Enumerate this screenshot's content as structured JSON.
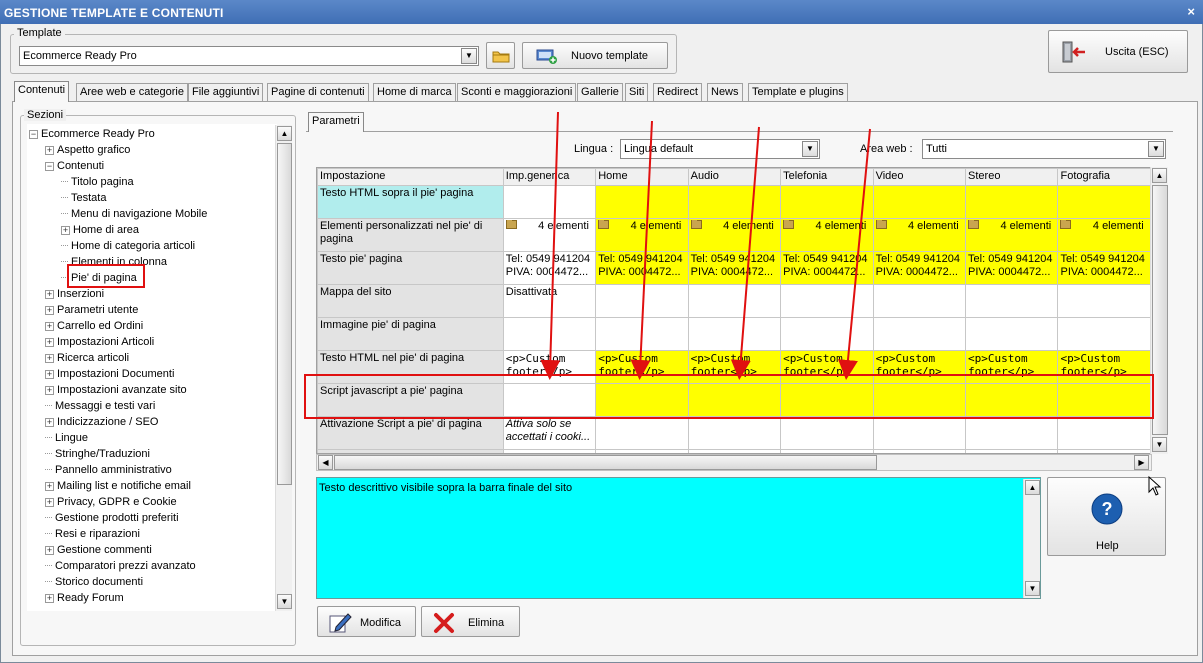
{
  "window": {
    "title": "GESTIONE TEMPLATE E CONTENUTI",
    "close_glyph": "×"
  },
  "template_group": {
    "label": "Template",
    "selected": "Ecommerce Ready Pro",
    "new_button": "Nuovo template"
  },
  "exit_button": "Uscita (ESC)",
  "tabs": [
    {
      "label": "Contenuti"
    },
    {
      "label": "Aree web e categorie"
    },
    {
      "label": "File aggiuntivi"
    },
    {
      "label": "Pagine di contenuti"
    },
    {
      "label": "Home di marca"
    },
    {
      "label": "Sconti e maggiorazioni"
    },
    {
      "label": "Gallerie"
    },
    {
      "label": "Siti"
    },
    {
      "label": "Redirect"
    },
    {
      "label": "News"
    },
    {
      "label": "Template e plugins"
    }
  ],
  "sections": {
    "label": "Sezioni",
    "tree": [
      {
        "label": "Ecommerce Ready Pro",
        "expander": "−"
      },
      {
        "label": "Aspetto grafico",
        "expander": "+"
      },
      {
        "label": "Contenuti",
        "expander": "−"
      },
      {
        "label": "Titolo pagina"
      },
      {
        "label": "Testata"
      },
      {
        "label": "Menu di navigazione Mobile"
      },
      {
        "label": "Home di area",
        "expander": "+"
      },
      {
        "label": "Home di categoria articoli"
      },
      {
        "label": "Elementi in colonna"
      },
      {
        "label": "Pie' di pagina"
      },
      {
        "label": "Inserzioni",
        "expander": "+"
      },
      {
        "label": "Parametri utente",
        "expander": "+"
      },
      {
        "label": "Carrello ed Ordini",
        "expander": "+"
      },
      {
        "label": "Impostazioni Articoli",
        "expander": "+"
      },
      {
        "label": "Ricerca articoli",
        "expander": "+"
      },
      {
        "label": "Impostazioni Documenti",
        "expander": "+"
      },
      {
        "label": "Impostazioni avanzate sito",
        "expander": "+"
      },
      {
        "label": "Messaggi e testi vari"
      },
      {
        "label": "Indicizzazione / SEO",
        "expander": "+"
      },
      {
        "label": "Lingue"
      },
      {
        "label": "Stringhe/Traduzioni"
      },
      {
        "label": "Pannello amministrativo"
      },
      {
        "label": "Mailing list e notifiche email",
        "expander": "+"
      },
      {
        "label": "Privacy, GDPR e Cookie",
        "expander": "+"
      },
      {
        "label": "Gestione prodotti preferiti"
      },
      {
        "label": "Resi e riparazioni"
      },
      {
        "label": "Gestione commenti",
        "expander": "+"
      },
      {
        "label": "Comparatori prezzi avanzato"
      },
      {
        "label": "Storico documenti"
      },
      {
        "label": "Ready Forum",
        "expander": "+"
      }
    ]
  },
  "params_tab": "Parametri",
  "lingua": {
    "label": "Lingua :",
    "value": "Lingua default"
  },
  "area_web": {
    "label": "Area web :",
    "value": "Tutti"
  },
  "grid": {
    "columns": [
      "Impostazione",
      "Imp.generica",
      "Home",
      "Audio",
      "Telefonia",
      "Video",
      "Stereo",
      "Fotografia"
    ],
    "rows": [
      {
        "name": "Testo HTML sopra il pie' pagina",
        "generic": "",
        "values": [
          "",
          "",
          "",
          "",
          "",
          ""
        ]
      },
      {
        "name": "Elementi personalizzati nel pie' di pagina",
        "generic": "4 elementi",
        "values": [
          "4 elementi",
          "4 elementi",
          "4 elementi",
          "4 elementi",
          "4 elementi",
          "4 elementi"
        ]
      },
      {
        "name": "Testo pie' pagina",
        "generic": "Tel: 0549 941204 PIVA: 0004472...",
        "values": [
          "Tel: 0549 941204 PIVA: 0004472...",
          "Tel: 0549 941204 PIVA: 0004472...",
          "Tel: 0549 941204 PIVA: 0004472...",
          "Tel: 0549 941204 PIVA: 0004472...",
          "Tel: 0549 941204 PIVA: 0004472...",
          "Tel: 0549 941204 PIVA: 0004472..."
        ]
      },
      {
        "name": "Mappa del sito",
        "generic": "Disattivata",
        "values": [
          "",
          "",
          "",
          "",
          "",
          ""
        ]
      },
      {
        "name": "Immagine pie' di pagina",
        "generic": "",
        "values": [
          "",
          "",
          "",
          "",
          "",
          ""
        ]
      },
      {
        "name": "Testo HTML nel pie' di pagina",
        "generic": "<p>Custom footer</p>",
        "values": [
          "<p>Custom footer</p>",
          "<p>Custom footer</p>",
          "<p>Custom footer</p>",
          "<p>Custom footer</p>",
          "<p>Custom footer</p>",
          "<p>Custom footer</p>"
        ]
      },
      {
        "name": "Script javascript a pie' pagina",
        "generic": "",
        "values": [
          "",
          "",
          "",
          "",
          "",
          ""
        ]
      },
      {
        "name": "Attivazione Script a pie' di pagina",
        "generic": "Attiva solo se accettati i cooki...",
        "values": [
          "",
          "",
          "",
          "",
          "",
          ""
        ]
      },
      {
        "name": "",
        "generic": "",
        "values": [
          "",
          "",
          "",
          "",
          "",
          ""
        ]
      }
    ]
  },
  "description": "Testo descrittivo visibile sopra la barra finale del sito",
  "help_button": "Help",
  "modifica_button": "Modifica",
  "elimina_button": "Elimina",
  "colors": {
    "highlight": "#ffff00",
    "description_bg": "#00ffff",
    "annotation": "#e01010",
    "title_bar": "#4a7bc0"
  }
}
